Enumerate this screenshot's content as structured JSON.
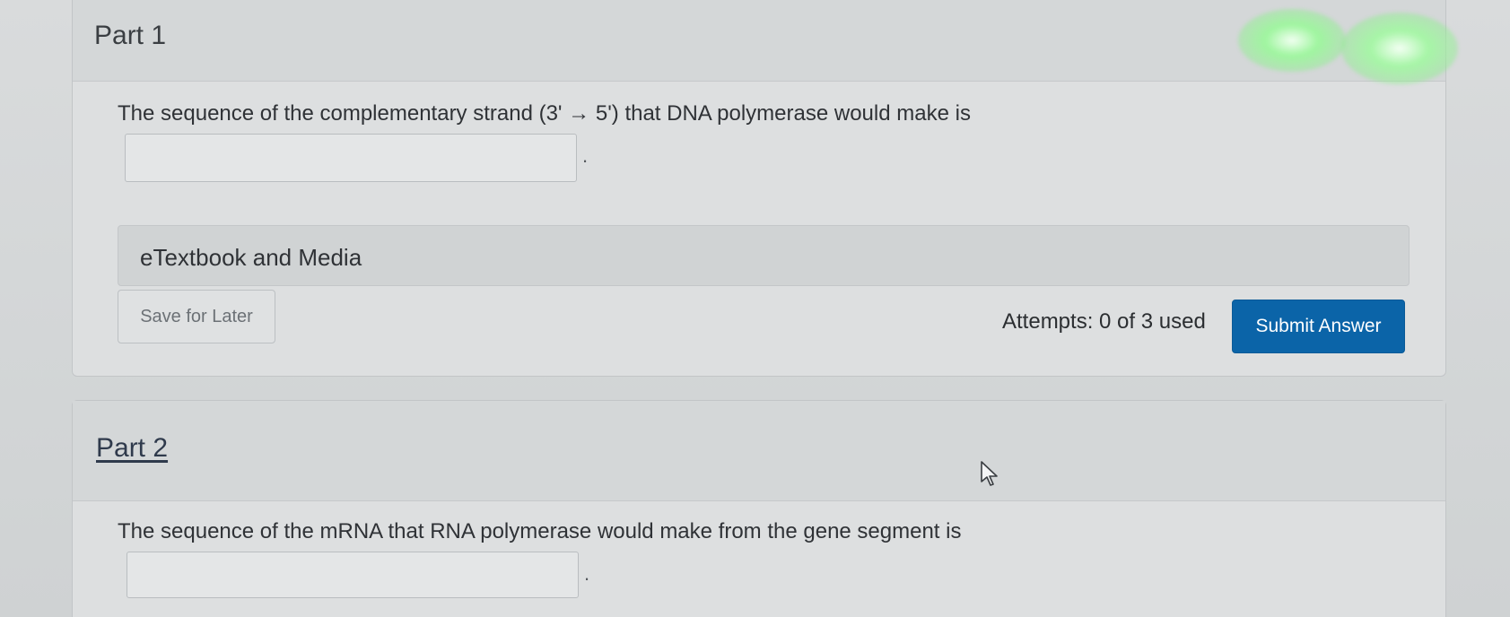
{
  "part1": {
    "title": "Part 1",
    "question": "The sequence of the complementary strand (3'  →  5') that DNA polymerase would make is",
    "answer_value": "",
    "trailing_period": ".",
    "etextbook_label": "eTextbook and Media",
    "save_label": "Save for Later",
    "attempts_text": "Attempts: 0 of 3 used",
    "submit_label": "Submit Answer"
  },
  "part2": {
    "title": "Part 2",
    "question": "The sequence of the mRNA that RNA polymerase would make from the gene segment is",
    "answer_value": "",
    "trailing_period": "."
  },
  "colors": {
    "submit_bg": "#0b64a8",
    "background": "#d9dbdc",
    "glare": "#7cf27c"
  },
  "icons": {
    "cursor": "mouse-pointer-icon"
  }
}
